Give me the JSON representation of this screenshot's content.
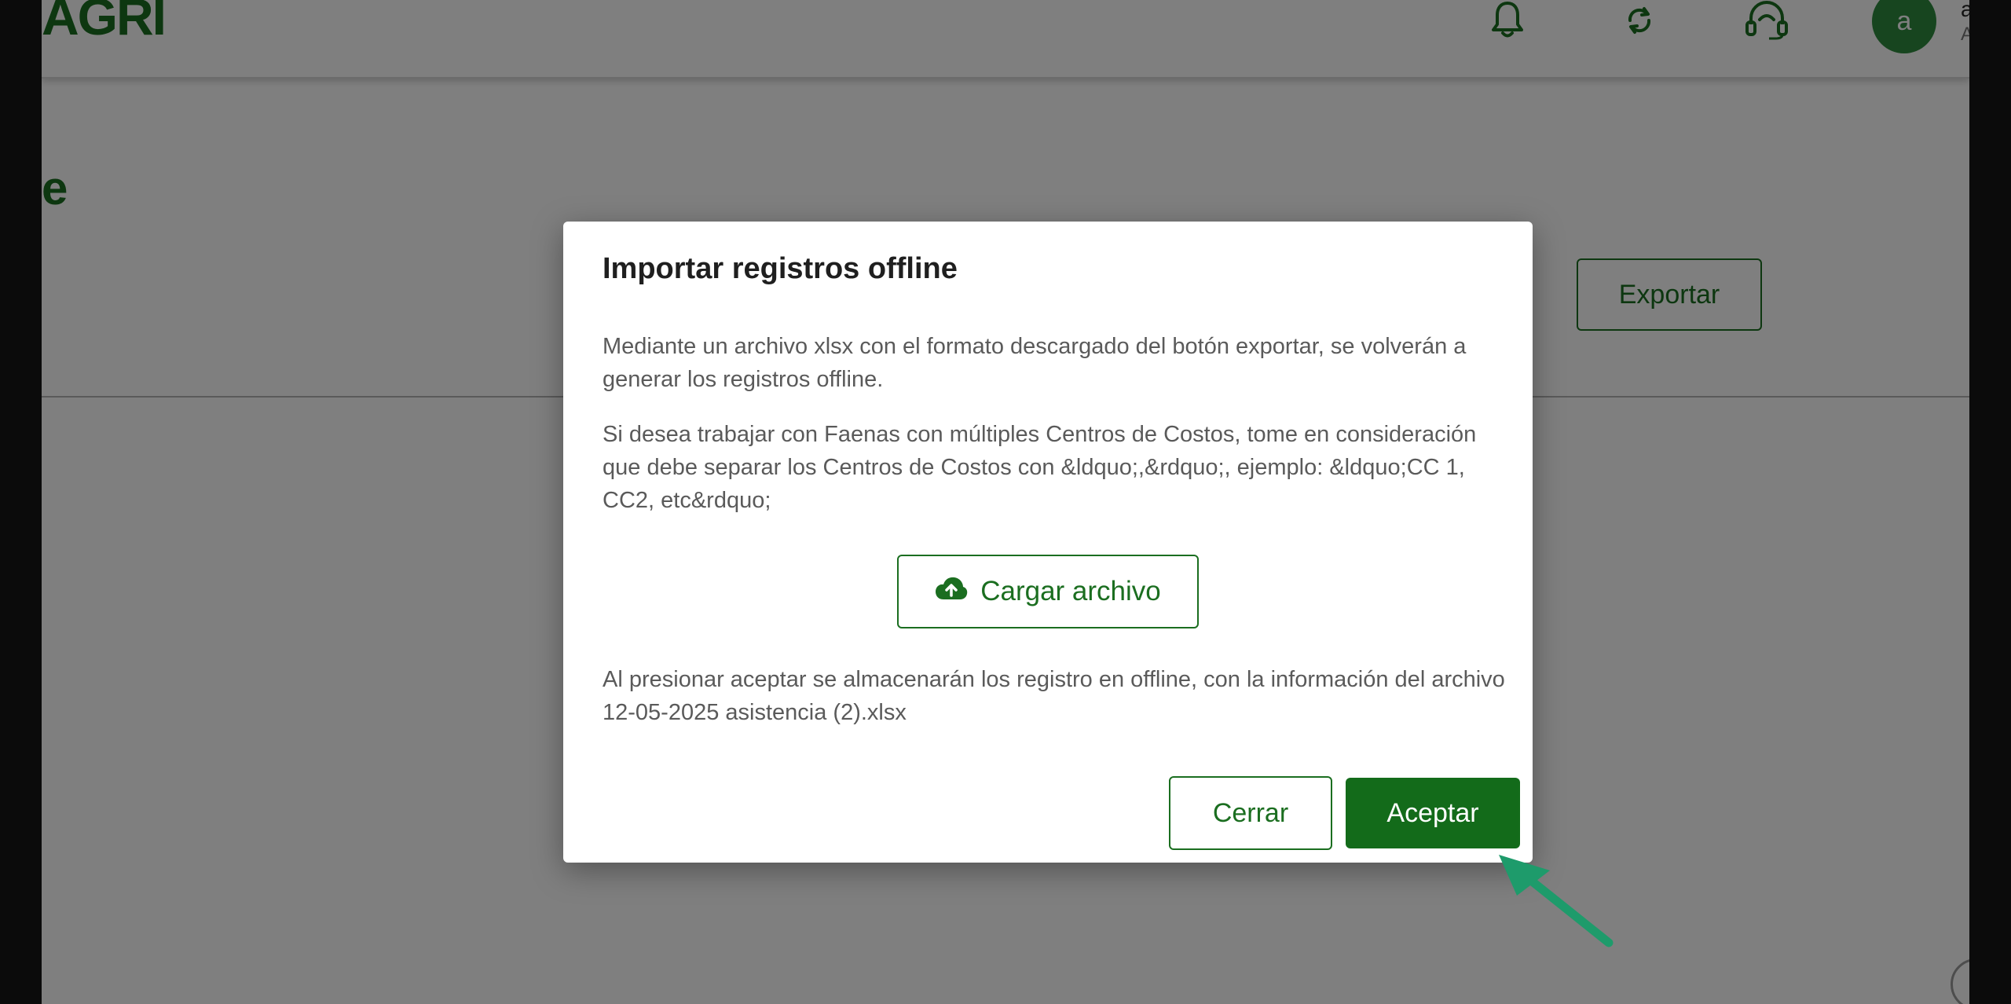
{
  "app": {
    "logo_text": "AGRI",
    "page_title": "e",
    "export_label": "Exportar",
    "user": {
      "avatar_initial": "a",
      "name_fragment": "a",
      "sub_fragment": "A"
    }
  },
  "icons": {
    "notifications": "bell-icon",
    "sync": "sync-icon",
    "support": "headset-icon",
    "upload": "cloud-upload-icon"
  },
  "modal": {
    "title": "Importar registros offline",
    "paragraph1": "Mediante un archivo xlsx con el formato descargado del botón exportar, se volverán a generar los registros offline.",
    "paragraph2": "Si desea trabajar con Faenas con múltiples Centros de Costos, tome en consideración que debe separar los Centros de Costos con &ldquo;,&rdquo;, ejemplo: &ldquo;CC 1, CC2, etc&rdquo;",
    "upload_label": "Cargar archivo",
    "paragraph3": "Al presionar aceptar se almacenarán los registro en offline, con la información del archivo 12-05-2025 asistencia (2).xlsx",
    "close_label": "Cerrar",
    "accept_label": "Aceptar"
  },
  "colors": {
    "brand_green": "#1b6e20",
    "accept_bg": "#136b1a",
    "avatar_bg": "#2e8b3e",
    "annotation_arrow": "#1e9b6b"
  }
}
